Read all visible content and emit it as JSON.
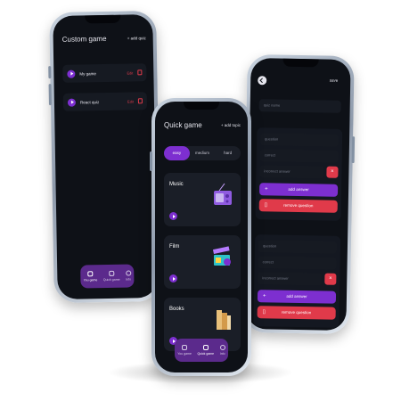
{
  "colors": {
    "accent": "#7d2fd0",
    "danger": "#e03a4a",
    "background": "#0e1117",
    "card": "#1a1e27"
  },
  "custom_screen": {
    "title": "Custom game",
    "add_label": "+ add quiz",
    "quizzes": [
      {
        "name": "My game",
        "edit": "Edit"
      },
      {
        "name": "React quiz",
        "edit": "Edit"
      }
    ],
    "nav": [
      {
        "label": "You game"
      },
      {
        "label": "Quick game"
      },
      {
        "label": "Info"
      }
    ]
  },
  "quick_screen": {
    "title": "Quick game",
    "add_label": "+ add topic",
    "difficulty": [
      {
        "label": "easy"
      },
      {
        "label": "medium"
      },
      {
        "label": "hard"
      }
    ],
    "topics": [
      {
        "name": "Music",
        "icon": "radio-icon"
      },
      {
        "name": "Film",
        "icon": "clapperboard-icon"
      },
      {
        "name": "Books",
        "icon": "books-icon"
      }
    ],
    "nav": [
      {
        "label": "You game"
      },
      {
        "label": "Quick game"
      },
      {
        "label": "Info"
      }
    ]
  },
  "editor_screen": {
    "save_label": "save",
    "quiz_name_placeholder": "quiz name",
    "question_blocks": [
      {
        "question": "question",
        "correct": "correct",
        "incorrect": "incorrect answer",
        "close": "×",
        "add_answer": "add answer",
        "remove_question": "remove question"
      },
      {
        "question": "question",
        "correct": "correct",
        "incorrect": "incorrect answer",
        "close": "×",
        "add_answer": "add answer",
        "remove_question": "remove question"
      }
    ]
  }
}
